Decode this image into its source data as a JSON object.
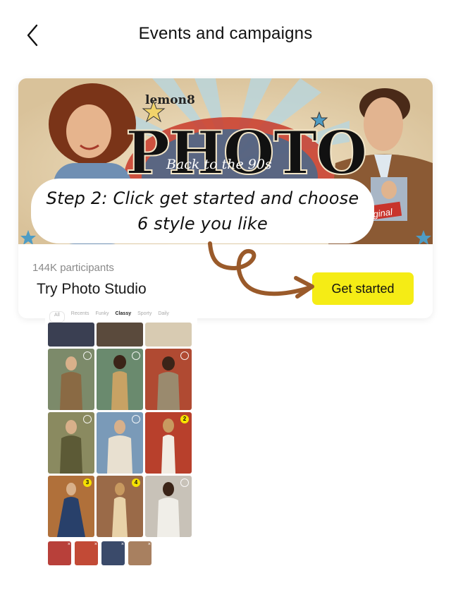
{
  "header": {
    "title": "Events and campaigns"
  },
  "banner": {
    "brand": "lemon8",
    "headline": "PHOTO",
    "tagline": "Back to the 90s",
    "badge": "ginal"
  },
  "card": {
    "participants": "144K participants",
    "event_name": "Try Photo Studio",
    "cta_label": "Get started"
  },
  "overlay": {
    "line1": "Step 2: Click get started and choose",
    "line2": "6 style you like"
  },
  "inset": {
    "tabs": [
      "All",
      "Recents",
      "Funky",
      "Classy",
      "Sporty",
      "Daily"
    ],
    "active_tab": "Classy",
    "selected_numbers": [
      "2",
      "3",
      "4"
    ],
    "thumb_close": "×",
    "colors": {
      "accent": "#f5ec15"
    }
  }
}
